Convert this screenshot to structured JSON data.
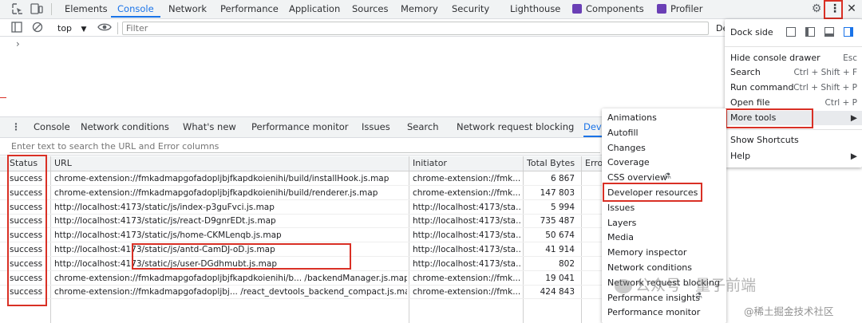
{
  "toolbar": {
    "tabs": [
      {
        "label": "Elements"
      },
      {
        "label": "Console"
      },
      {
        "label": "Network"
      },
      {
        "label": "Performance"
      },
      {
        "label": "Application"
      },
      {
        "label": "Sources"
      },
      {
        "label": "Memory"
      },
      {
        "label": "Security"
      },
      {
        "label": "Lighthouse"
      },
      {
        "label": "Components"
      },
      {
        "label": "Profiler"
      }
    ],
    "active_tab": "Console"
  },
  "console_bar": {
    "context": "top",
    "filter_placeholder": "Filter",
    "truncated_right": "De",
    "prompt": "›"
  },
  "drawer": {
    "tabs": [
      {
        "label": "Console"
      },
      {
        "label": "Network conditions"
      },
      {
        "label": "What's new"
      },
      {
        "label": "Performance monitor"
      },
      {
        "label": "Issues"
      },
      {
        "label": "Search"
      },
      {
        "label": "Network request blocking"
      },
      {
        "label": "Dev"
      }
    ],
    "search_placeholder": "Enter text to search the URL and Error columns"
  },
  "table": {
    "headers": {
      "status": "Status",
      "url": "URL",
      "initiator": "Initiator",
      "bytes": "Total Bytes",
      "error": "Erro"
    },
    "rows": [
      {
        "status": "success",
        "url": "chrome-extension://fmkadmapgofadopljbjfkapdkoienihi/build/installHook.js.map",
        "initiator": "chrome-extension://fmk...",
        "bytes": "6 867"
      },
      {
        "status": "success",
        "url": "chrome-extension://fmkadmapgofadopljbjfkapdkoienihi/build/renderer.js.map",
        "initiator": "chrome-extension://fmk...",
        "bytes": "147 803"
      },
      {
        "status": "success",
        "url": "http://localhost:4173/static/js/index-p3guFvci.js.map",
        "initiator": "http://localhost:4173/sta...",
        "bytes": "5 994"
      },
      {
        "status": "success",
        "url": "http://localhost:4173/static/js/react-D9gnrEDt.js.map",
        "initiator": "http://localhost:4173/sta...",
        "bytes": "735 487"
      },
      {
        "status": "success",
        "url": "http://localhost:4173/static/js/home-CKMLenqb.js.map",
        "initiator": "http://localhost:4173/sta...",
        "bytes": "50 674"
      },
      {
        "status": "success",
        "url": "http://localhost:4173/static/js/antd-CamDJ-oD.js.map",
        "initiator": "http://localhost:4173/sta...",
        "bytes": "41 914"
      },
      {
        "status": "success",
        "url": "http://localhost:4173/static/js/user-DGdhmubt.js.map",
        "initiator": "http://localhost:4173/sta...",
        "bytes": "802"
      },
      {
        "status": "success",
        "url": "chrome-extension://fmkadmapgofadopljbjfkapdkoienihi/b... /backendManager.js.map",
        "initiator": "chrome-extension://fmk...",
        "bytes": "19 041"
      },
      {
        "status": "success",
        "url": "chrome-extension://fmkadmapgofadopljbj... /react_devtools_backend_compact.js.map",
        "initiator": "chrome-extension://fmk...",
        "bytes": "424 843"
      }
    ]
  },
  "main_menu": {
    "dock_side": "Dock side",
    "items": [
      {
        "label": "Hide console drawer",
        "shortcut": "Esc"
      },
      {
        "label": "Search",
        "shortcut": "Ctrl + Shift + F"
      },
      {
        "label": "Run command",
        "shortcut": "Ctrl + Shift + P"
      },
      {
        "label": "Open file",
        "shortcut": "Ctrl + P"
      },
      {
        "label": "More tools",
        "shortcut": ""
      },
      {
        "label": "Show Shortcuts",
        "shortcut": ""
      },
      {
        "label": "Help",
        "shortcut": ""
      }
    ]
  },
  "more_tools_menu": {
    "items": [
      {
        "label": "Animations"
      },
      {
        "label": "Autofill"
      },
      {
        "label": "Changes"
      },
      {
        "label": "Coverage"
      },
      {
        "label": "CSS overview"
      },
      {
        "label": "Developer resources"
      },
      {
        "label": "Issues"
      },
      {
        "label": "Layers"
      },
      {
        "label": "Media"
      },
      {
        "label": "Memory inspector"
      },
      {
        "label": "Network conditions"
      },
      {
        "label": "Network request blocking"
      },
      {
        "label": "Performance insights"
      },
      {
        "label": "Performance monitor"
      }
    ]
  },
  "watermark": {
    "top_line": "公众号 · 量子前端",
    "bottom_line": "@稀土掘金技术社区"
  },
  "colors": {
    "accent": "#1a73e8",
    "highlight": "#d93025",
    "toolbar_bg": "#f1f3f4"
  }
}
